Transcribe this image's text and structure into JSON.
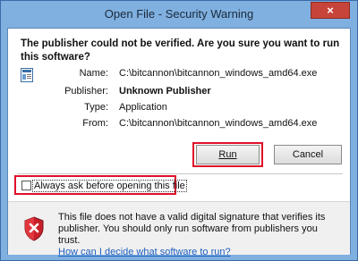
{
  "window": {
    "title": "Open File - Security Warning",
    "close_glyph": "×"
  },
  "heading": "The publisher could not be verified.  Are you sure you want to run this software?",
  "fields": [
    {
      "label": "Name:",
      "value": "C:\\bitcannon\\bitcannon_windows_amd64.exe"
    },
    {
      "label": "Publisher:",
      "value": "Unknown Publisher"
    },
    {
      "label": "Type:",
      "value": "Application"
    },
    {
      "label": "From:",
      "value": "C:\\bitcannon\\bitcannon_windows_amd64.exe"
    }
  ],
  "buttons": {
    "run": "Run",
    "cancel": "Cancel"
  },
  "checkbox": {
    "label": "Always ask before opening this file",
    "checked": false
  },
  "footer": {
    "warning_text": "This file does not have a valid digital signature that verifies its publisher.  You should only run software from publishers you trust.",
    "link_text": "How can I decide what software to run?"
  },
  "colors": {
    "highlight": "#e0102a",
    "close_button": "#c7443a",
    "link": "#1f5fbf"
  },
  "icons": {
    "document": "document-icon",
    "shield": "shield-error-icon"
  }
}
